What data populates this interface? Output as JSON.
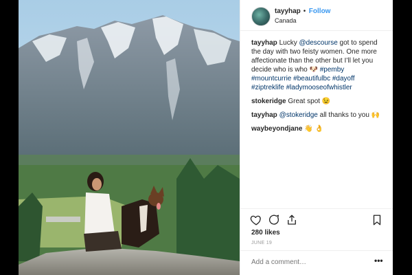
{
  "post": {
    "username": "tayyhap",
    "separator": "•",
    "follow_label": "Follow",
    "location": "Canada"
  },
  "comments": [
    {
      "user": "tayyhap",
      "parts": [
        {
          "text": " Lucky "
        },
        {
          "text": "@descourse",
          "link": true
        },
        {
          "text": " got to spend the day with two feisty women. One more affectionate than the other but I’ll let you decide who is who 🐶 "
        },
        {
          "text": "#pemby",
          "link": true
        },
        {
          "text": " "
        },
        {
          "text": "#mountcurrie",
          "link": true
        },
        {
          "text": " "
        },
        {
          "text": "#beautifulbc",
          "link": true
        },
        {
          "text": " "
        },
        {
          "text": "#dayoff",
          "link": true
        },
        {
          "text": " "
        },
        {
          "text": "#ziptreklife",
          "link": true
        },
        {
          "text": " "
        },
        {
          "text": "#ladymooseofwhistler",
          "link": true
        }
      ]
    },
    {
      "user": "stokeridge",
      "parts": [
        {
          "text": " Great spot 😉"
        }
      ]
    },
    {
      "user": "tayyhap",
      "parts": [
        {
          "text": " "
        },
        {
          "text": "@stokeridge",
          "link": true
        },
        {
          "text": " all thanks to you 🙌"
        }
      ]
    },
    {
      "user": "waybeyondjane",
      "parts": [
        {
          "text": " 👋 👌"
        }
      ]
    }
  ],
  "actions": {
    "like_icon": "heart-icon",
    "comment_icon": "comment-icon",
    "share_icon": "share-icon",
    "save_icon": "bookmark-icon"
  },
  "likes": "280 likes",
  "date": "JUNE 19",
  "add_comment": {
    "placeholder": "Add a comment…",
    "more_label": "•••"
  },
  "colors": {
    "link": "#003569",
    "follow": "#3897f0",
    "text": "#262626",
    "muted": "#999999"
  }
}
